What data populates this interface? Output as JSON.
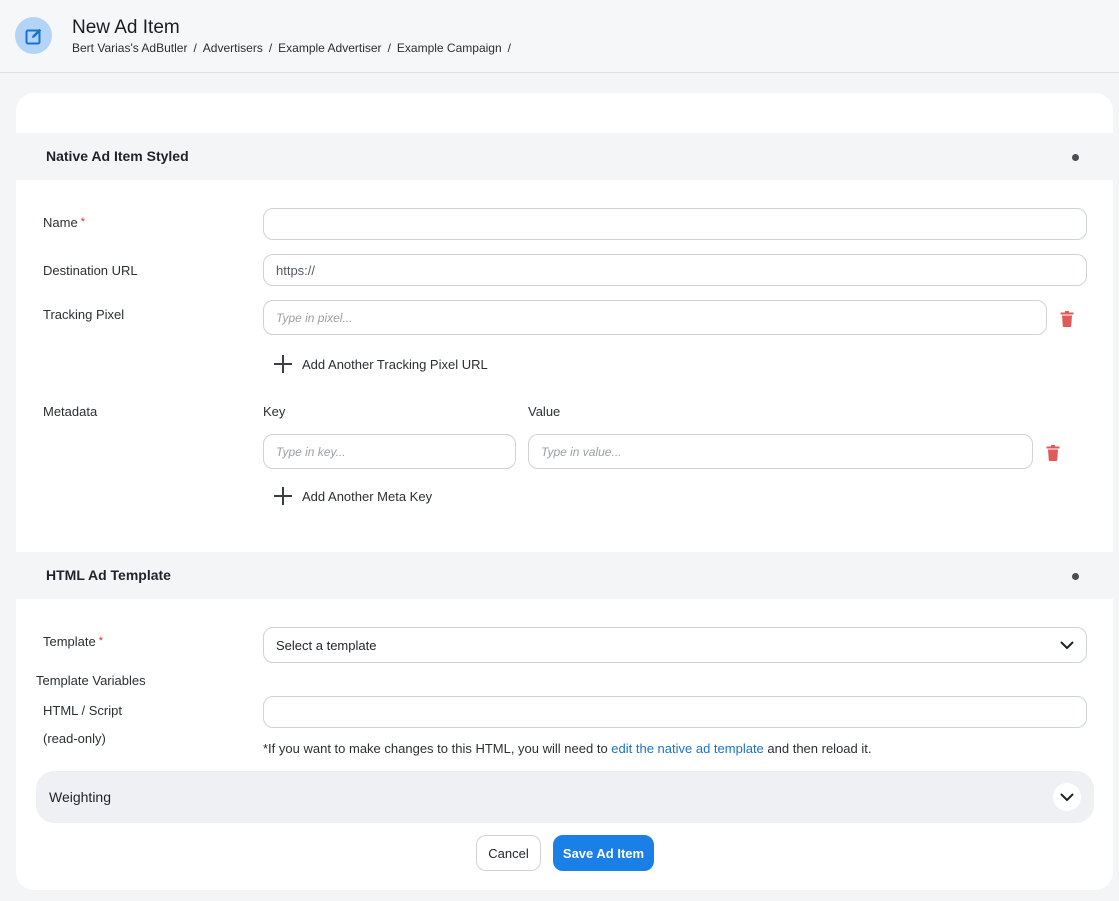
{
  "header": {
    "title": "New Ad Item",
    "breadcrumb": [
      "Bert Varias's AdButler",
      "Advertisers",
      "Example Advertiser",
      "Example Campaign"
    ],
    "separator": "/"
  },
  "native_section": {
    "title": "Native Ad Item Styled",
    "name_label": "Name",
    "required_mark": "*",
    "name_value": "",
    "destination_label": "Destination URL",
    "destination_value": "https://",
    "tracking_label": "Tracking Pixel",
    "tracking_placeholder": "Type in pixel...",
    "add_tracking_label": "Add Another Tracking Pixel URL",
    "metadata_label": "Metadata",
    "key_header": "Key",
    "value_header": "Value",
    "key_placeholder": "Type in key...",
    "value_placeholder": "Type in value...",
    "add_meta_label": "Add Another Meta Key"
  },
  "template_section": {
    "title": "HTML Ad Template",
    "template_label": "Template",
    "required_mark": "*",
    "template_selected": "Select a template",
    "variables_label": "Template Variables",
    "html_label": "HTML / Script",
    "readonly_label": "(read-only)",
    "html_value": "",
    "note_before": "*If you want to make changes to this HTML, you will need to ",
    "note_link": "edit the native ad template",
    "note_after": " and then reload it."
  },
  "weighting": {
    "title": "Weighting"
  },
  "actions": {
    "cancel_label": "Cancel",
    "save_label": "Save Ad Item"
  },
  "colors": {
    "primary": "#1a7fe6",
    "danger": "#e05a5a",
    "link": "#1a73c8"
  }
}
